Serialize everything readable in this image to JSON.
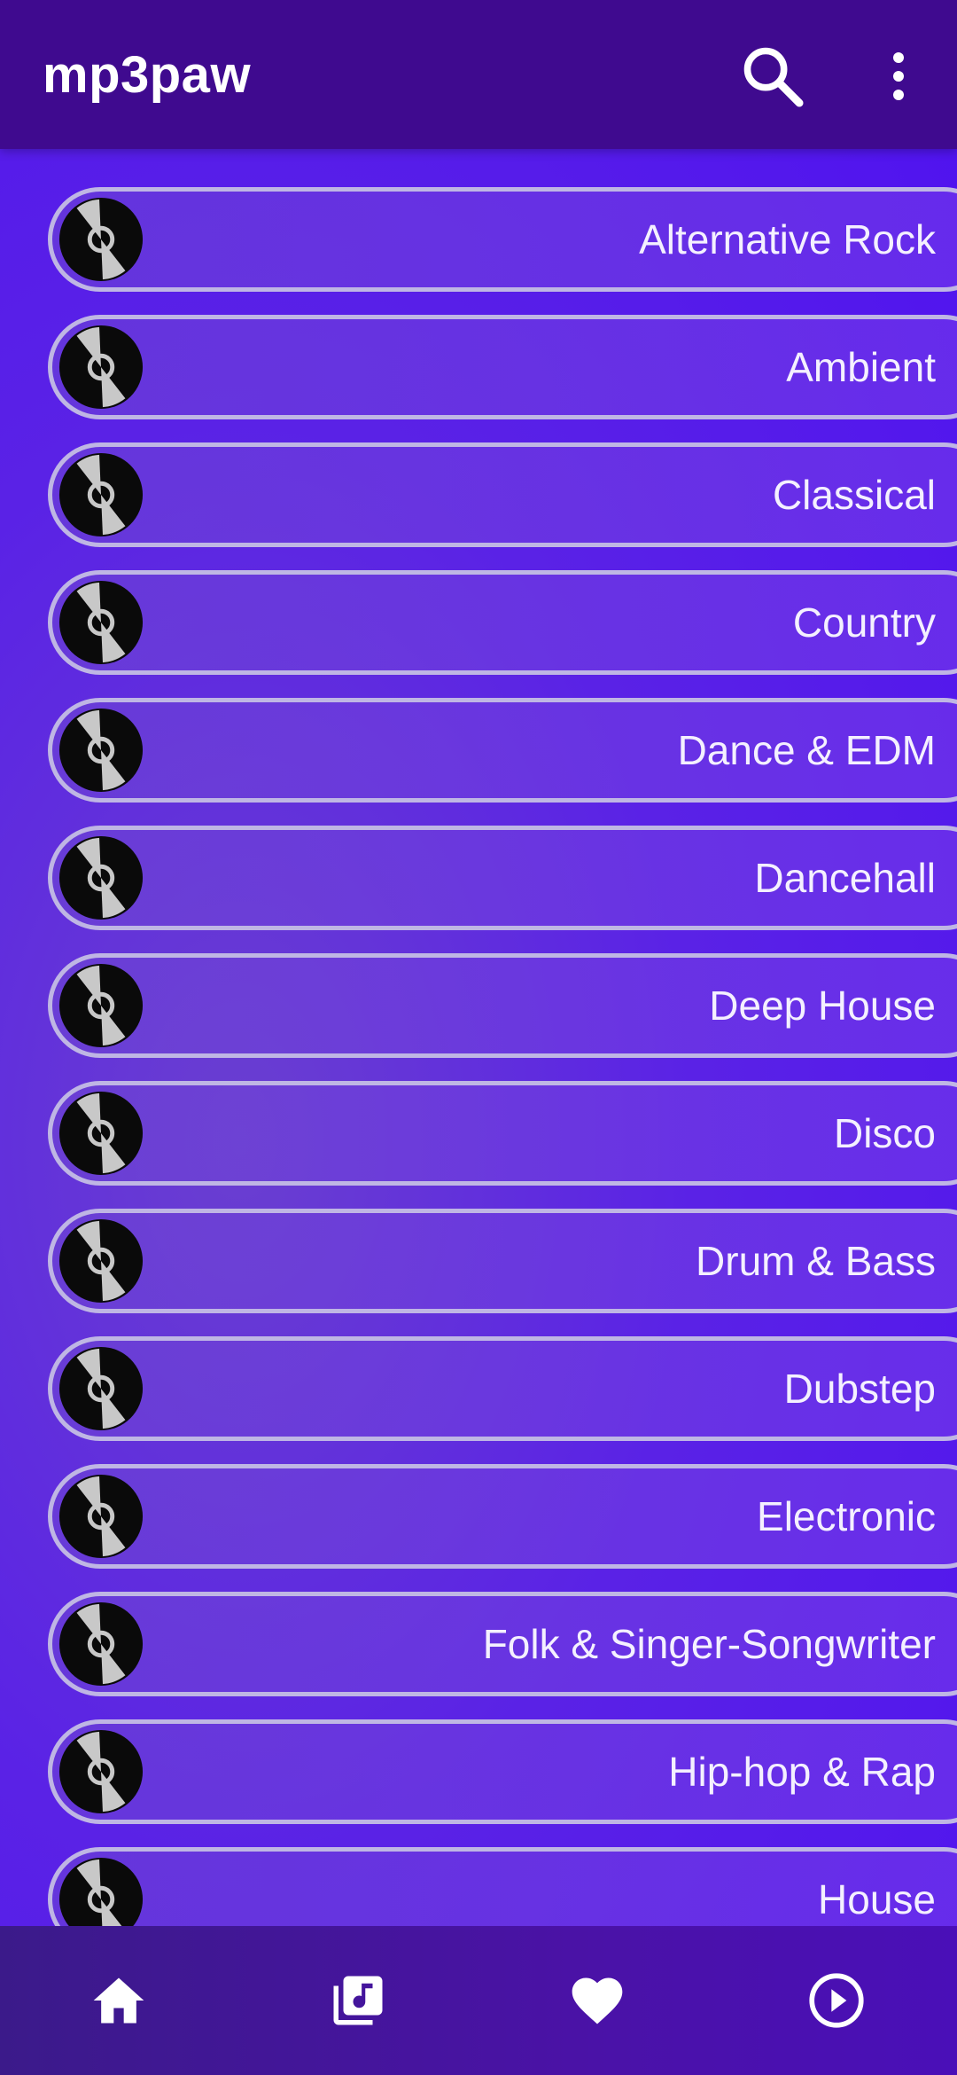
{
  "appbar": {
    "title": "mp3paw",
    "icons": [
      "search-icon",
      "more-vert-icon"
    ]
  },
  "genres": [
    "Alternative Rock",
    "Ambient",
    "Classical",
    "Country",
    "Dance & EDM",
    "Dancehall",
    "Deep House",
    "Disco",
    "Drum & Bass",
    "Dubstep",
    "Electronic",
    "Folk & Singer-Songwriter",
    "Hip-hop & Rap",
    "House"
  ],
  "bottom_nav": {
    "items": [
      "home-icon",
      "library-music-icon",
      "favorite-icon",
      "play-circle-icon"
    ]
  },
  "colors": {
    "appbar": "#3f0a8f",
    "background": "#5a22e6",
    "item_border": "#bfb6e4",
    "text": "#ffffff"
  }
}
